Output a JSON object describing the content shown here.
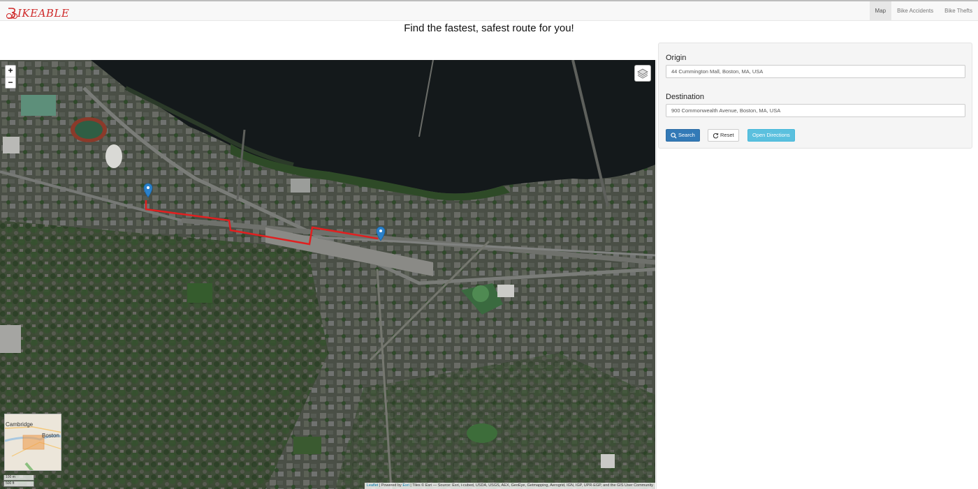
{
  "navbar": {
    "brand": "IKEABLE",
    "links": [
      {
        "label": "Map",
        "active": true
      },
      {
        "label": "Bike Accidents",
        "active": false
      },
      {
        "label": "Bike Thefts",
        "active": false
      }
    ]
  },
  "tagline": "Find the fastest, safest route for you!",
  "map": {
    "zoom_in": "+",
    "zoom_out": "−",
    "layers_icon": "layers-icon",
    "minimap": {
      "label_cambridge": "Cambridge",
      "label_boston": "Boston"
    },
    "scale": {
      "metric": "100 m",
      "imperial": "500 ft"
    },
    "attribution": {
      "leaflet": "Leaflet",
      "sep1": " | Powered by ",
      "esri": "Esri",
      "rest": " | Tiles © Esri — Source: Esri, i-cubed, USDA, USGS, AEX, GeoEye, Getmapping, Aerogrid, IGN, IGP, UPR-EGP, and the GIS User Community"
    },
    "route_color": "#e02020",
    "marker_color": "#2a81cb"
  },
  "form": {
    "origin_label": "Origin",
    "origin_value": "44 Cummington Mall, Boston, MA, USA",
    "destination_label": "Destination",
    "destination_value": "900 Commonwealth Avenue, Boston, MA, USA",
    "search_label": "Search",
    "search_icon": "search-icon",
    "reset_label": "Reset",
    "reset_icon": "refresh-icon",
    "directions_label": "Open Directions"
  }
}
